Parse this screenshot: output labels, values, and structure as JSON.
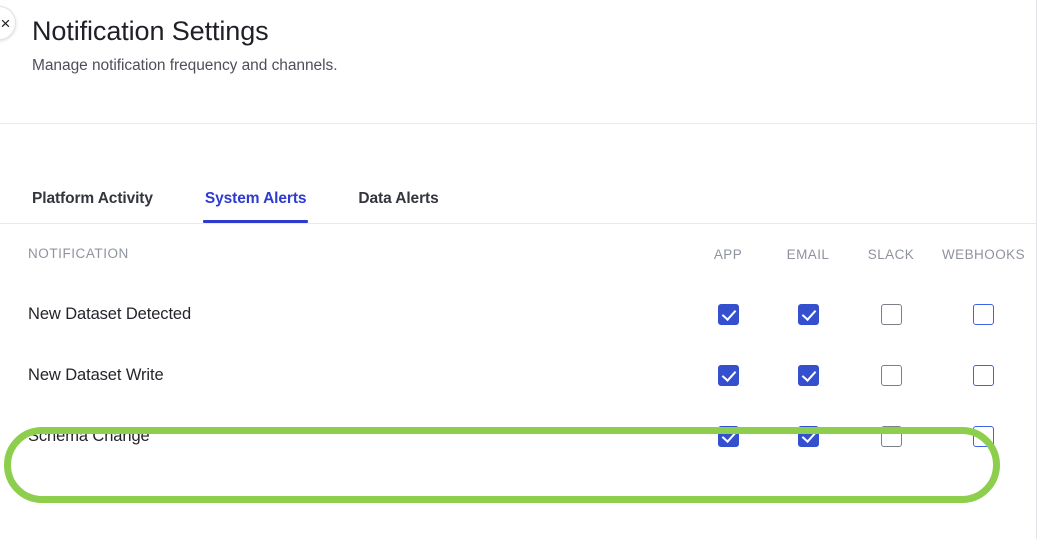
{
  "header": {
    "title": "Notification Settings",
    "subtitle": "Manage notification frequency and channels.",
    "close_icon": "×"
  },
  "tabs": [
    {
      "label": "Platform Activity",
      "active": false
    },
    {
      "label": "System Alerts",
      "active": true
    },
    {
      "label": "Data Alerts",
      "active": false
    }
  ],
  "table": {
    "columns": {
      "notification": "NOTIFICATION",
      "app": "APP",
      "email": "EMAIL",
      "slack": "SLACK",
      "webhooks": "WEBHOOKS"
    },
    "rows": [
      {
        "name": "New Dataset Detected",
        "app": "checked",
        "email": "checked",
        "slack": "unchecked-gray",
        "webhooks": "unchecked-blue"
      },
      {
        "name": "New Dataset Write",
        "app": "checked",
        "email": "checked",
        "slack": "unchecked-gray",
        "webhooks": "unchecked-blue"
      },
      {
        "name": "Schema Change",
        "app": "checked",
        "email": "checked",
        "slack": "unchecked-gray",
        "webhooks": "unchecked-blue",
        "highlighted": true
      }
    ]
  },
  "annotation": {
    "type": "ellipse-highlight",
    "target_row": "Schema Change",
    "color": "#8ece4d"
  },
  "colors": {
    "accent": "#2f3ad0",
    "checkbox_checked": "#3550cf",
    "checkbox_border_blue": "#3f63e8",
    "checkbox_border_gray": "#7b7f88",
    "highlight_green": "#8ece4d",
    "text_primary": "#23252b",
    "text_muted": "#8f939e",
    "divider": "#e8eaee"
  }
}
